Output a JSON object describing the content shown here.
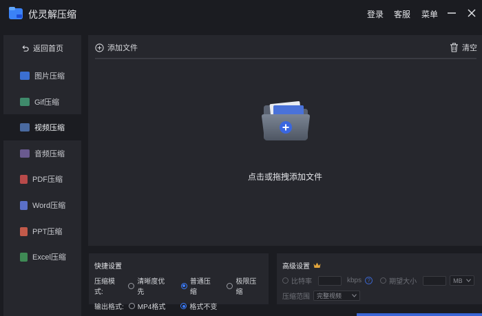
{
  "app": {
    "title": "优灵解压缩"
  },
  "titlebar": {
    "login": "登录",
    "service": "客服",
    "menu": "菜单"
  },
  "sidebar": {
    "home": "返回首页",
    "items": [
      {
        "label": "图片压缩",
        "icon": "image-icon"
      },
      {
        "label": "Gif压缩",
        "icon": "gif-icon"
      },
      {
        "label": "视频压缩",
        "icon": "video-icon",
        "active": true
      },
      {
        "label": "音频压缩",
        "icon": "audio-icon"
      },
      {
        "label": "PDF压缩",
        "icon": "pdf-icon"
      },
      {
        "label": "Word压缩",
        "icon": "word-icon"
      },
      {
        "label": "PPT压缩",
        "icon": "ppt-icon"
      },
      {
        "label": "Excel压缩",
        "icon": "excel-icon"
      }
    ]
  },
  "main": {
    "add_file": "添加文件",
    "clear": "清空",
    "drop_label": "点击或拖拽添加文件"
  },
  "quick": {
    "title": "快捷设置",
    "mode_label": "压缩模式:",
    "modes": [
      "清晰度优先",
      "普通压缩",
      "极限压缩"
    ],
    "mode_selected": "普通压缩",
    "format_label": "输出格式:",
    "formats": [
      "MP4格式",
      "格式不变"
    ],
    "format_selected": "格式不变"
  },
  "advanced": {
    "title": "高级设置",
    "bitrate_label": "比特率",
    "bitrate_unit": "kbps",
    "size_label": "期望大小",
    "size_unit": "MB",
    "range_label": "压缩范围",
    "range_value": "完整视频"
  },
  "colors": {
    "accent": "#3a7cff",
    "background": "#1b1c21",
    "panel": "#26272d"
  }
}
